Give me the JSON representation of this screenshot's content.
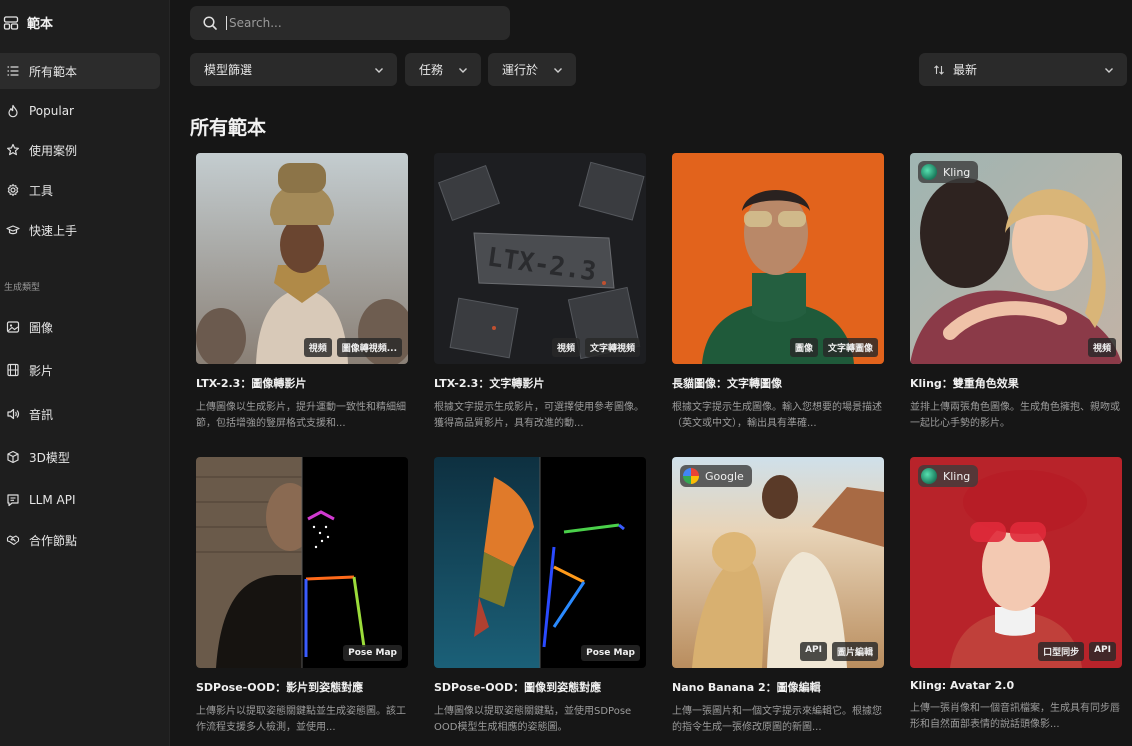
{
  "sidebar": {
    "brand": "範本",
    "items": [
      {
        "label": "所有範本"
      },
      {
        "label": "Popular"
      },
      {
        "label": "使用案例"
      },
      {
        "label": "工具"
      },
      {
        "label": "快速上手"
      }
    ],
    "section_label": "生成類型",
    "types": [
      {
        "label": "圖像"
      },
      {
        "label": "影片"
      },
      {
        "label": "音訊"
      },
      {
        "label": "3D模型"
      },
      {
        "label": "LLM API"
      },
      {
        "label": "合作節點"
      }
    ]
  },
  "search": {
    "placeholder": "Search..."
  },
  "filters": {
    "model": "模型篩選",
    "task": "任務",
    "runs_on": "運行於",
    "sort": "最新"
  },
  "page_title": "所有範本",
  "cards": [
    {
      "title": "LTX-2.3：圖像轉影片",
      "desc": "上傳圖像以生成影片，提升運動一致性和精細細節，包括增強的豎屏格式支援和...",
      "tags": [
        "視頻",
        "圖像轉視頻..."
      ]
    },
    {
      "title": "LTX-2.3：文字轉影片",
      "desc": "根據文字提示生成影片，可選擇使用參考圖像。獲得高品質影片，具有改進的動...",
      "tags": [
        "視頻",
        "文字轉視頻"
      ],
      "art_text": "LTX-2.3"
    },
    {
      "title": "長貓圖像：文字轉圖像",
      "desc": "根據文字提示生成圖像。輸入您想要的場景描述（英文或中文），輸出具有準確...",
      "tags": [
        "圖像",
        "文字轉圖像"
      ]
    },
    {
      "title": "Kling：雙重角色效果",
      "desc": "並排上傳兩張角色圖像。生成角色擁抱、親吻或一起比心手勢的影片。",
      "tags": [
        "視頻"
      ],
      "badge": "Kling"
    },
    {
      "title": "SDPose-OOD：影片到姿態對應",
      "desc": "上傳影片以提取姿態關鍵點並生成姿態圖。該工作流程支援多人檢測，並使用...",
      "tags": [
        "Pose Map"
      ]
    },
    {
      "title": "SDPose-OOD：圖像到姿態對應",
      "desc": "上傳圖像以提取姿態關鍵點，並使用SDPose OOD模型生成相應的姿態圖。",
      "tags": [
        "Pose Map"
      ]
    },
    {
      "title": "Nano Banana 2：圖像編輯",
      "desc": "上傳一張圖片和一個文字提示來編輯它。根據您的指令生成一張修改原圖的新圖...",
      "tags": [
        "API",
        "圖片編輯"
      ],
      "badge": "Google"
    },
    {
      "title": "Kling: Avatar 2.0",
      "desc": "上傳一張肖像和一個音訊檔案，生成具有同步唇形和自然面部表情的說話頭像影...",
      "tags": [
        "口型同步",
        "API"
      ],
      "badge": "Kling"
    }
  ]
}
